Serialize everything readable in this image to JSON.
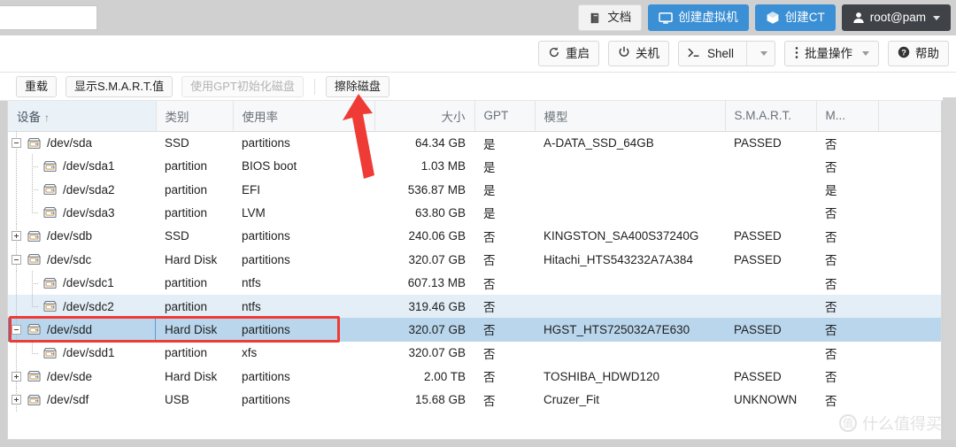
{
  "topbar": {
    "search_value": "",
    "search_placeholder": "",
    "buttons": [
      {
        "label": "文档",
        "icon": "book-icon",
        "style": "light"
      },
      {
        "label": "创建虚拟机",
        "icon": "monitor-icon",
        "style": "blue"
      },
      {
        "label": "创建CT",
        "icon": "cube-icon",
        "style": "blue"
      }
    ],
    "user": {
      "label": "root@pam",
      "icon": "user-icon",
      "caret": "chevron-down-icon"
    }
  },
  "actionbar": {
    "reboot": {
      "label": "重启",
      "icon": "restart-icon"
    },
    "shutdown": {
      "label": "关机",
      "icon": "power-icon"
    },
    "shell": {
      "label": "Shell",
      "icon": "terminal-icon",
      "caret": "chevron-down-icon"
    },
    "bulk": {
      "label": "批量操作",
      "icon": "kebab-icon",
      "caret": "chevron-down-icon"
    },
    "help": {
      "label": "帮助",
      "icon": "question-icon"
    }
  },
  "disktoolbar": {
    "reload": "重载",
    "show_smart": "显示S.M.A.R.T.值",
    "init_gpt": "使用GPT初始化磁盘",
    "wipe_disk": "擦除磁盘"
  },
  "grid": {
    "columns": [
      {
        "key": "device",
        "label": "设备",
        "sorted": true,
        "sort_dir": "↑",
        "align": "left"
      },
      {
        "key": "type",
        "label": "类别",
        "align": "left"
      },
      {
        "key": "usage",
        "label": "使用率",
        "align": "left"
      },
      {
        "key": "size",
        "label": "大小",
        "align": "right"
      },
      {
        "key": "gpt",
        "label": "GPT",
        "align": "left"
      },
      {
        "key": "model",
        "label": "模型",
        "align": "left"
      },
      {
        "key": "smart",
        "label": "S.M.A.R.T.",
        "align": "left"
      },
      {
        "key": "m",
        "label": "M...",
        "align": "left"
      },
      {
        "key": "pad",
        "label": "",
        "align": "left"
      }
    ],
    "rows": [
      {
        "device": "/dev/sda",
        "depth": 0,
        "expander": "minus",
        "type": "SSD",
        "usage": "partitions",
        "size": "64.34 GB",
        "gpt": "是",
        "model": "A-DATA_SSD_64GB",
        "smart": "PASSED",
        "m": "否",
        "state": "normal"
      },
      {
        "device": "/dev/sda1",
        "depth": 1,
        "expander": "none",
        "type": "partition",
        "usage": "BIOS boot",
        "size": "1.03 MB",
        "gpt": "是",
        "model": "",
        "smart": "",
        "m": "否",
        "state": "normal"
      },
      {
        "device": "/dev/sda2",
        "depth": 1,
        "expander": "none",
        "type": "partition",
        "usage": "EFI",
        "size": "536.87 MB",
        "gpt": "是",
        "model": "",
        "smart": "",
        "m": "是",
        "state": "normal"
      },
      {
        "device": "/dev/sda3",
        "depth": 1,
        "expander": "none",
        "type": "partition",
        "usage": "LVM",
        "size": "63.80 GB",
        "gpt": "是",
        "model": "",
        "smart": "",
        "m": "否",
        "state": "normal"
      },
      {
        "device": "/dev/sdb",
        "depth": 0,
        "expander": "plus",
        "type": "SSD",
        "usage": "partitions",
        "size": "240.06 GB",
        "gpt": "否",
        "model": "KINGSTON_SA400S37240G",
        "smart": "PASSED",
        "m": "否",
        "state": "normal"
      },
      {
        "device": "/dev/sdc",
        "depth": 0,
        "expander": "minus",
        "type": "Hard Disk",
        "usage": "partitions",
        "size": "320.07 GB",
        "gpt": "否",
        "model": "Hitachi_HTS543232A7A384",
        "smart": "PASSED",
        "m": "否",
        "state": "normal"
      },
      {
        "device": "/dev/sdc1",
        "depth": 1,
        "expander": "none",
        "type": "partition",
        "usage": "ntfs",
        "size": "607.13 MB",
        "gpt": "否",
        "model": "",
        "smart": "",
        "m": "否",
        "state": "normal"
      },
      {
        "device": "/dev/sdc2",
        "depth": 1,
        "expander": "none",
        "type": "partition",
        "usage": "ntfs",
        "size": "319.46 GB",
        "gpt": "否",
        "model": "",
        "smart": "",
        "m": "否",
        "state": "hover"
      },
      {
        "device": "/dev/sdd",
        "depth": 0,
        "expander": "minus",
        "type": "Hard Disk",
        "usage": "partitions",
        "size": "320.07 GB",
        "gpt": "否",
        "model": "HGST_HTS725032A7E630",
        "smart": "PASSED",
        "m": "否",
        "state": "selected"
      },
      {
        "device": "/dev/sdd1",
        "depth": 1,
        "expander": "none",
        "type": "partition",
        "usage": "xfs",
        "size": "320.07 GB",
        "gpt": "否",
        "model": "",
        "smart": "",
        "m": "否",
        "state": "normal"
      },
      {
        "device": "/dev/sde",
        "depth": 0,
        "expander": "plus",
        "type": "Hard Disk",
        "usage": "partitions",
        "size": "2.00 TB",
        "gpt": "否",
        "model": "TOSHIBA_HDWD120",
        "smart": "PASSED",
        "m": "否",
        "state": "normal"
      },
      {
        "device": "/dev/sdf",
        "depth": 0,
        "expander": "plus",
        "type": "USB",
        "usage": "partitions",
        "size": "15.68 GB",
        "gpt": "否",
        "model": "Cruzer_Fit",
        "smart": "UNKNOWN",
        "m": "否",
        "state": "normal"
      }
    ]
  },
  "annotations": {
    "arrow": {
      "name": "red-arrow-pointing-to-wipe-disk",
      "color": "#ef3b36"
    },
    "rect": {
      "name": "red-highlight-selected-disk-row",
      "color": "#ef3b36"
    }
  },
  "watermark": {
    "logo": "值",
    "text": "什么值得买"
  },
  "colors": {
    "accent_blue": "#3b8fd4",
    "selected_row": "#b9d6ec",
    "hover_row": "#e3eef7",
    "header_bg": "#f6f8fa",
    "annotation_red": "#ef3b36",
    "user_dark": "#3f4246"
  }
}
